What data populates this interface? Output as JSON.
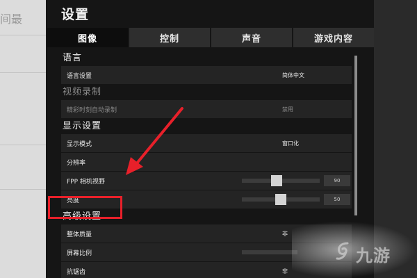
{
  "background_text": "间最",
  "title": "设置",
  "tabs": [
    {
      "label": "图像",
      "active": true
    },
    {
      "label": "控制",
      "active": false
    },
    {
      "label": "声音",
      "active": false
    },
    {
      "label": "游戏内容",
      "active": false
    }
  ],
  "sections": {
    "language": {
      "title": "语言",
      "rows": {
        "language_setting": {
          "label": "语言设置",
          "value": "简体中文"
        }
      }
    },
    "video": {
      "title": "视频录制",
      "rows": {
        "highlight_record": {
          "label": "精彩时刻自动录制",
          "value": "禁用"
        }
      }
    },
    "display": {
      "title": "显示设置",
      "rows": {
        "display_mode": {
          "label": "显示模式",
          "value": "窗口化"
        },
        "resolution": {
          "label": "分辨率"
        },
        "fpp_fov": {
          "label": "FPP 相机视野",
          "value": "90",
          "level": 0.45
        },
        "brightness": {
          "label": "亮度",
          "value": "50",
          "level": 0.5
        }
      }
    },
    "advanced": {
      "title": "高级设置",
      "rows": {
        "overall_quality": {
          "label": "整体质量",
          "value": "非"
        },
        "screen_scale": {
          "label": "屏幕比例"
        },
        "anti_aliasing": {
          "label": "抗锯齿",
          "value": "非"
        }
      }
    }
  },
  "annotation": {
    "color": "#e8202a"
  },
  "watermark": {
    "text": "九游",
    "logo": "jiuyou-logo"
  }
}
